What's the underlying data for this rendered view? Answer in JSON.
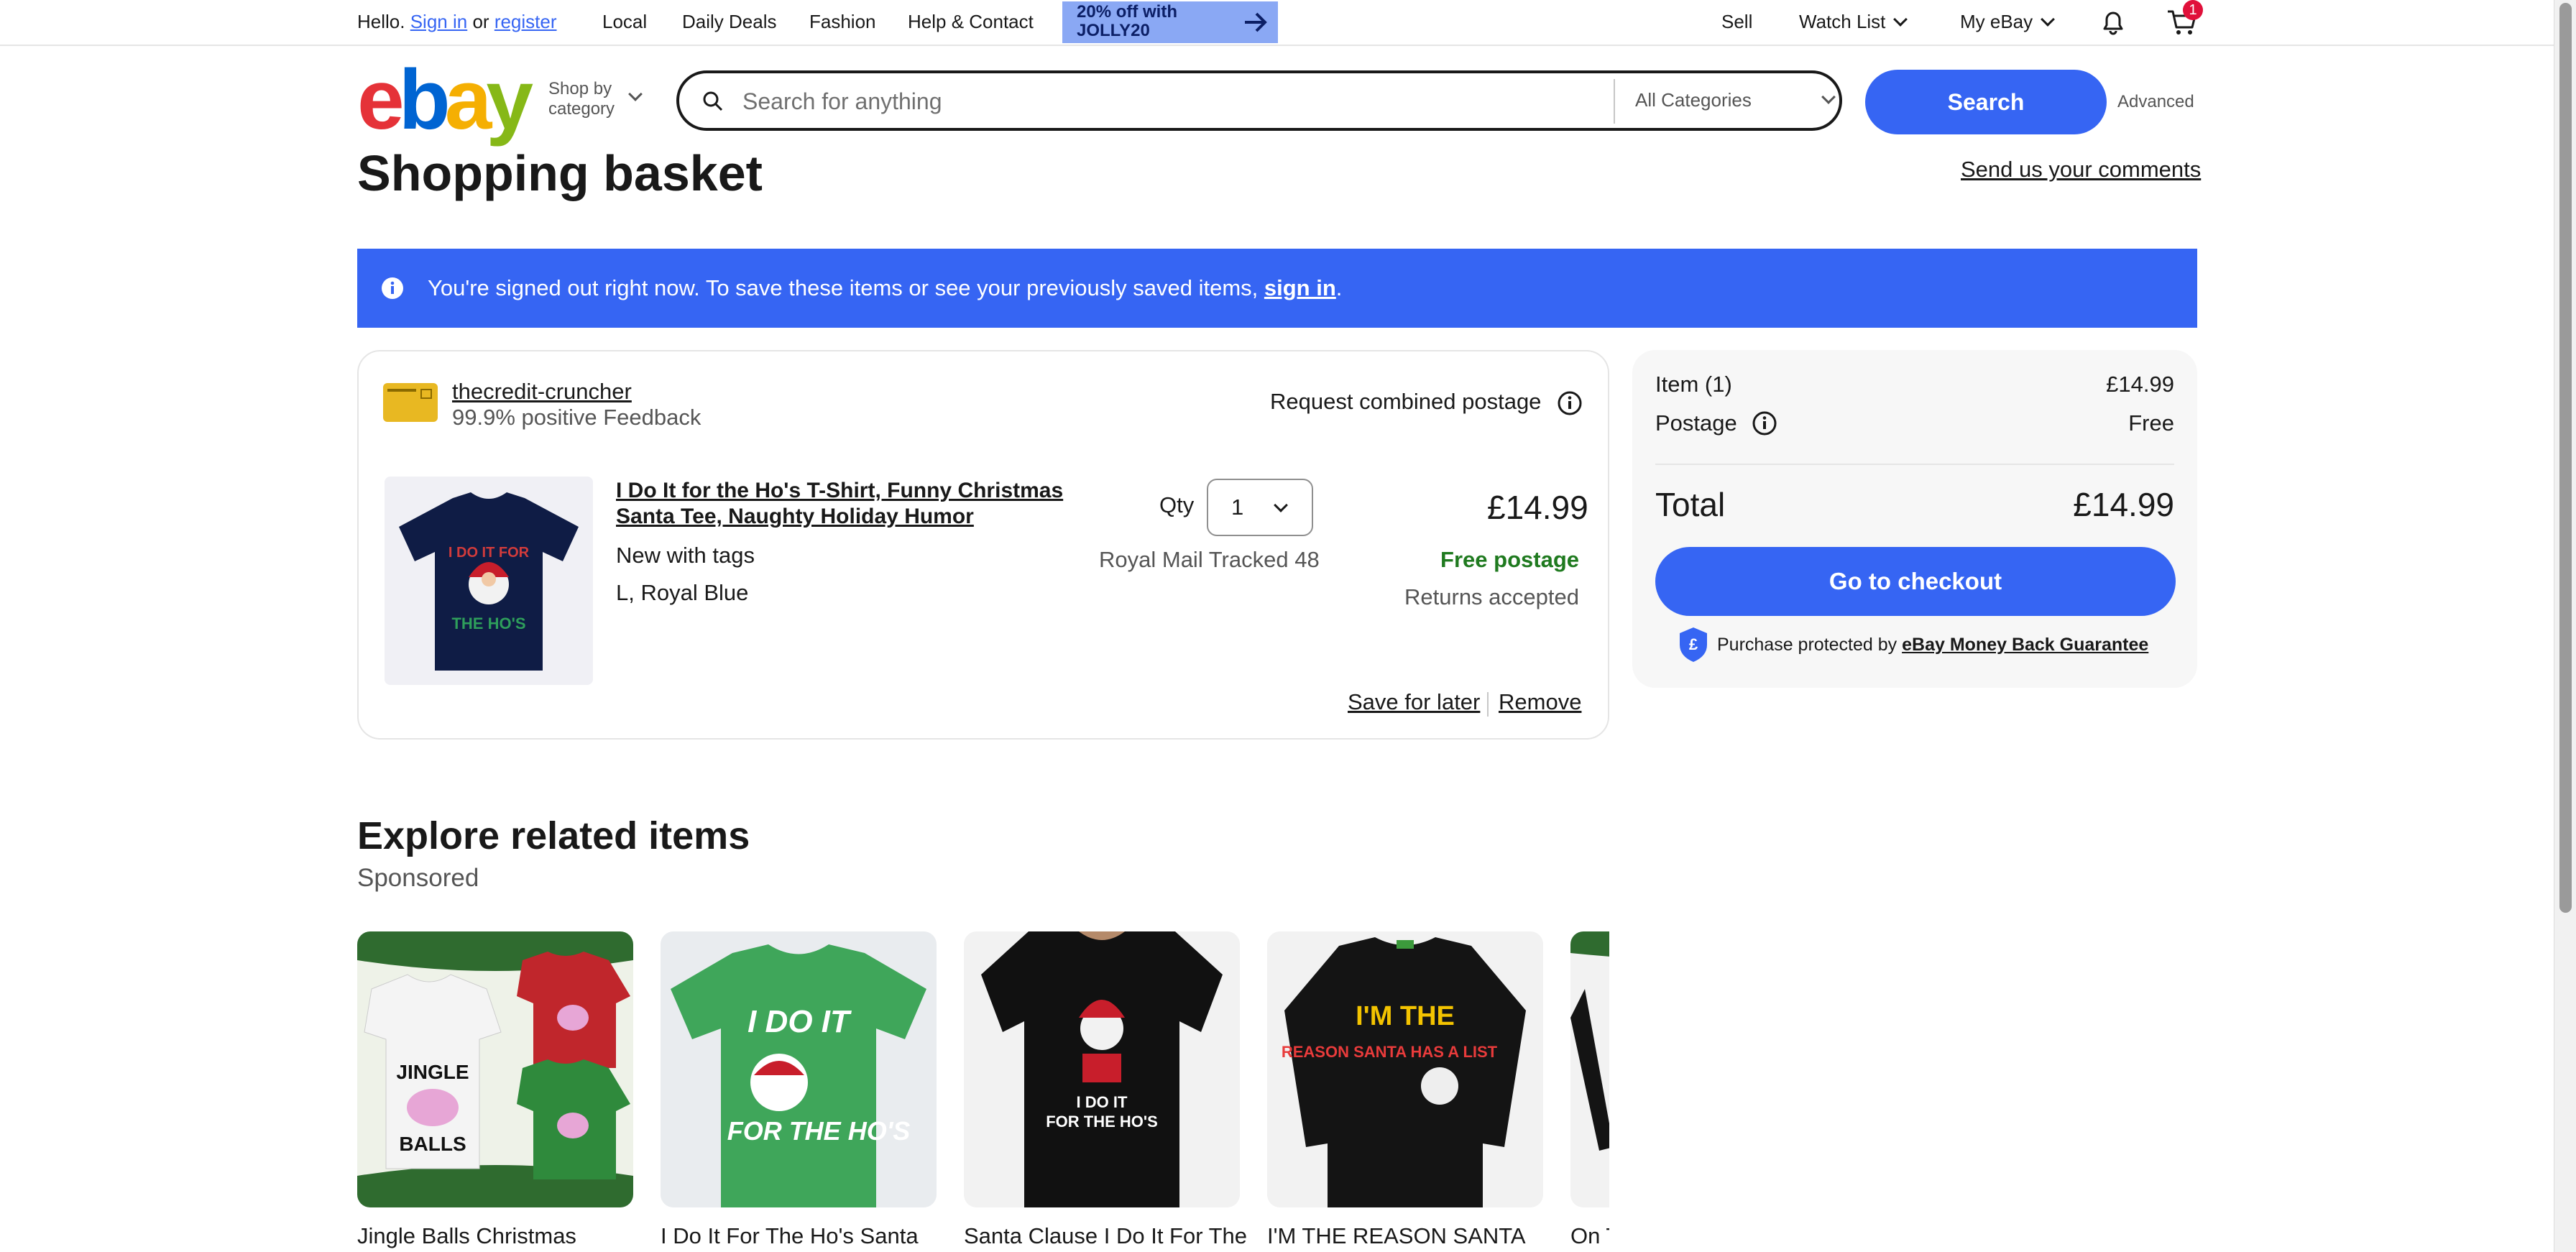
{
  "topbar": {
    "greeting": "Hello.",
    "sign_in": "Sign in",
    "or": "or",
    "register": "register",
    "nav": [
      "Local",
      "Daily Deals",
      "Fashion",
      "Help & Contact"
    ],
    "promo": {
      "line1": "20% off with",
      "line2": "JOLLY20"
    },
    "right": {
      "sell": "Sell",
      "watch_list": "Watch List",
      "my_ebay": "My eBay",
      "cart_count": "1"
    }
  },
  "header": {
    "logo_letters": [
      "e",
      "b",
      "a",
      "y"
    ],
    "logo_colors": [
      "#e53238",
      "#0064d2",
      "#f5af02",
      "#86b817"
    ],
    "shop_by_line1": "Shop by",
    "shop_by_line2": "category",
    "search_placeholder": "Search for anything",
    "category": "All Categories",
    "search_button": "Search",
    "advanced": "Advanced"
  },
  "page": {
    "title": "Shopping basket",
    "feedback_link": "Send us your comments"
  },
  "banner": {
    "message": "You're signed out right now. To save these items or see your previously saved items,",
    "link": "sign in",
    "end": "."
  },
  "cart": {
    "seller": {
      "name": "thecredit-cruncher",
      "feedback": "99.9% positive Feedback"
    },
    "combined_postage": "Request combined postage",
    "item": {
      "title": "I Do It for the Ho's T-Shirt, Funny Christmas Santa Tee, Naughty Holiday Humor",
      "condition": "New with tags",
      "variation": "L, Royal Blue",
      "qty_label": "Qty",
      "qty_value": "1",
      "shipping_method": "Royal Mail Tracked 48",
      "price": "£14.99",
      "postage": "Free postage",
      "returns": "Returns accepted",
      "shirt_text_top": "I DO IT FOR",
      "shirt_text_bottom": "THE HO'S"
    },
    "actions": {
      "save_later": "Save for later",
      "remove": "Remove"
    }
  },
  "summary": {
    "item_label": "Item (1)",
    "item_value": "£14.99",
    "postage_label": "Postage",
    "postage_value": "Free",
    "total_label": "Total",
    "total_value": "£14.99",
    "checkout": "Go to checkout",
    "guarantee_prefix": "Purchase protected by",
    "guarantee_link": "eBay Money Back Guarantee"
  },
  "related": {
    "title": "Explore related items",
    "sponsored": "Sponsored",
    "items": [
      {
        "title": "Jingle Balls Christmas",
        "img_text_1": "JINGLE",
        "img_text_2": "BALLS"
      },
      {
        "title": "I Do It For The Ho's Santa",
        "img_text_1": "I DO IT",
        "img_text_2": "FOR THE HO'S"
      },
      {
        "title": "Santa Clause I Do It For The",
        "img_text_1": "I DO IT",
        "img_text_2": "FOR THE HO'S"
      },
      {
        "title": "I'M THE REASON SANTA",
        "img_text_1": "I'M THE",
        "img_text_2": "REASON SANTA HAS A LIST"
      },
      {
        "title": "On T",
        "img_text_1": "",
        "img_text_2": ""
      }
    ]
  }
}
